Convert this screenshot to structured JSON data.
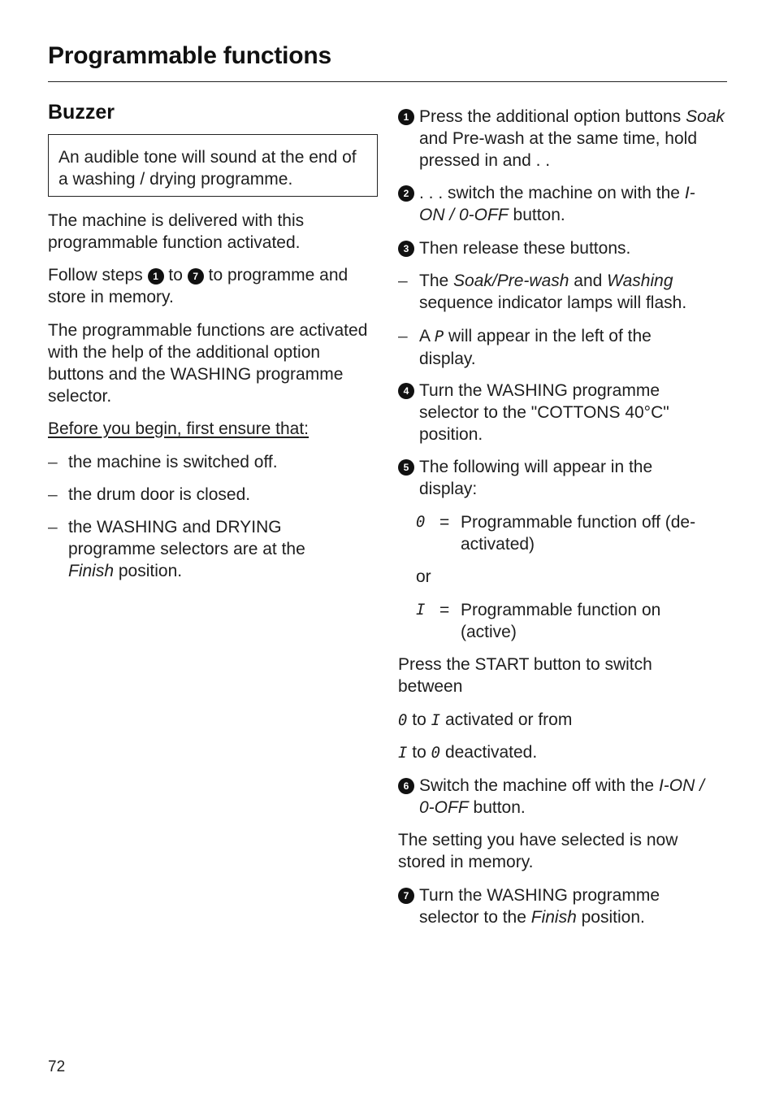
{
  "header": {
    "title": "Programmable functions"
  },
  "section": {
    "title": "Buzzer",
    "note": "An audible tone will sound at the end of a washing / drying programme."
  },
  "left": {
    "para1": "The machine is delivered with this programmable function activated.",
    "para2": {
      "before": "Follow steps",
      "step_from": "1",
      "middle": "to",
      "step_to": "7",
      "after": "to programme and store in memory."
    },
    "para3": "The programmable functions are activated with the help of the additional option buttons and the WASHING programme selector.",
    "prereq_heading": "Before you begin, first ensure that:",
    "prereqs": [
      {
        "text": "the machine is switched off."
      },
      {
        "text": "the drum door is closed."
      },
      {
        "text": "the WASHING and DRYING programme selectors are at the",
        "italic": "Finish",
        "after": "position."
      }
    ],
    "dash": "–"
  },
  "right": {
    "steps": [
      {
        "num": "1",
        "line1": "Press the additional option buttons",
        "italic": "Soak",
        "rest": "and Pre-wash at the same time, hold pressed in and . ."
      },
      {
        "num": "2",
        "text": ". . . switch the machine on with the",
        "italic": "I-ON / 0-OFF",
        "after": "button."
      },
      {
        "num": "3",
        "text": "Then release these buttons."
      },
      {
        "num": "4",
        "text": "Turn the WASHING programme selector to the \"COTTONS 40°C\" position."
      },
      {
        "num": "5",
        "text": "The following will appear in the display:"
      },
      {
        "num": "6",
        "text": "Switch the machine off with the",
        "italic": "I-ON / 0-OFF",
        "after": "button."
      },
      {
        "num": "7",
        "text": "Turn the WASHING programme selector to the",
        "italic": "Finish",
        "after": "position."
      }
    ],
    "dash_items": [
      {
        "pre": "The",
        "italic1": "Soak/Pre-wash",
        "mid": "and",
        "italic2": "Washing",
        "post": "sequence indicator lamps will flash."
      },
      {
        "pre": "A",
        "symbol": "P",
        "post": "will appear in the left of the display."
      }
    ],
    "display_states": [
      {
        "symbol": "0",
        "eq": "=",
        "desc": "Programmable function off (de-activated)"
      },
      {
        "symbol": "I",
        "eq": "=",
        "desc": "Programmable function on (active)"
      }
    ],
    "or_label": "or",
    "start_para": "Press the START button to switch between",
    "toggle1": {
      "from": "0",
      "to_word": "to",
      "to": "I",
      "after": "activated or from"
    },
    "toggle2": {
      "from": "I",
      "to_word": "to",
      "to": "0",
      "after": "deactivated."
    },
    "stored_para": "The setting you have selected is now stored in memory.",
    "dash": "–"
  },
  "footer": {
    "page_number": "72"
  }
}
